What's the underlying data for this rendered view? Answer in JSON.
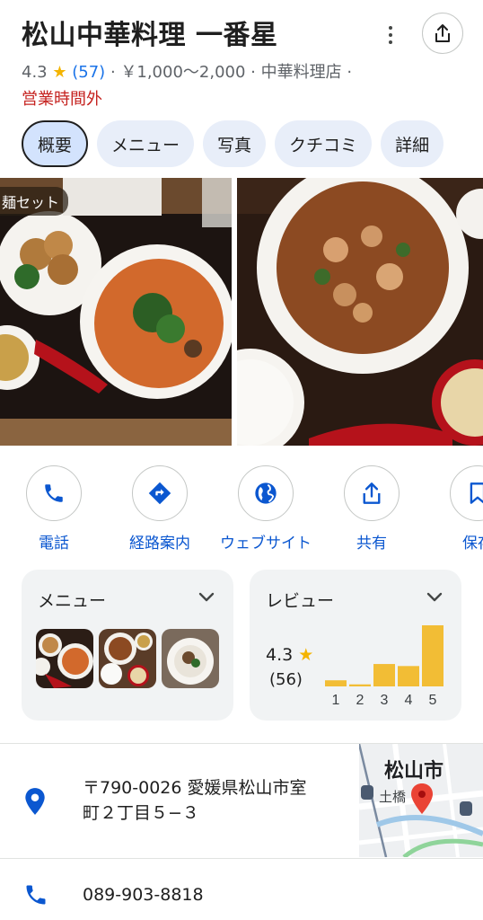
{
  "place": {
    "name": "松山中華料理 一番星",
    "rating": "4.3",
    "star": "★",
    "review_count": "(57)",
    "price_and_category": "· ￥1,000〜2,000 · 中華料理店 ·",
    "status": "営業時間外"
  },
  "tabs": [
    {
      "label": "概要",
      "active": true
    },
    {
      "label": "メニュー",
      "active": false
    },
    {
      "label": "写真",
      "active": false
    },
    {
      "label": "クチコミ",
      "active": false
    },
    {
      "label": "詳細",
      "active": false
    }
  ],
  "photos": {
    "first_label": "麺セット"
  },
  "actions": [
    {
      "label": "電話",
      "icon": "phone-icon"
    },
    {
      "label": "経路案内",
      "icon": "directions-icon"
    },
    {
      "label": "ウェブサイト",
      "icon": "globe-icon"
    },
    {
      "label": "共有",
      "icon": "share-icon"
    },
    {
      "label": "保存",
      "icon": "bookmark-icon"
    }
  ],
  "menu_card": {
    "title": "メニュー"
  },
  "review_card": {
    "title": "レビュー",
    "rating": "4.3",
    "star": "★",
    "count": "(56)"
  },
  "chart_data": {
    "type": "bar",
    "categories": [
      "1",
      "2",
      "3",
      "4",
      "5"
    ],
    "values": [
      3,
      1,
      11,
      10,
      30
    ],
    "ylim": [
      0,
      30
    ],
    "xlabel": "",
    "ylabel": "",
    "title": ""
  },
  "address": {
    "text_line1": "〒790-0026 愛媛県松山市室",
    "text_line2": "町２丁目５−３",
    "map_label": "松山市",
    "map_sublabel": "土橋"
  },
  "phone": {
    "number": "089-903-8818"
  },
  "colors": {
    "accent_blue": "#0b57d0",
    "closed_red": "#c5221f",
    "star_gold": "#f4b400",
    "bar_gold": "#f2bd35",
    "chip_bg": "#e8eef9"
  }
}
